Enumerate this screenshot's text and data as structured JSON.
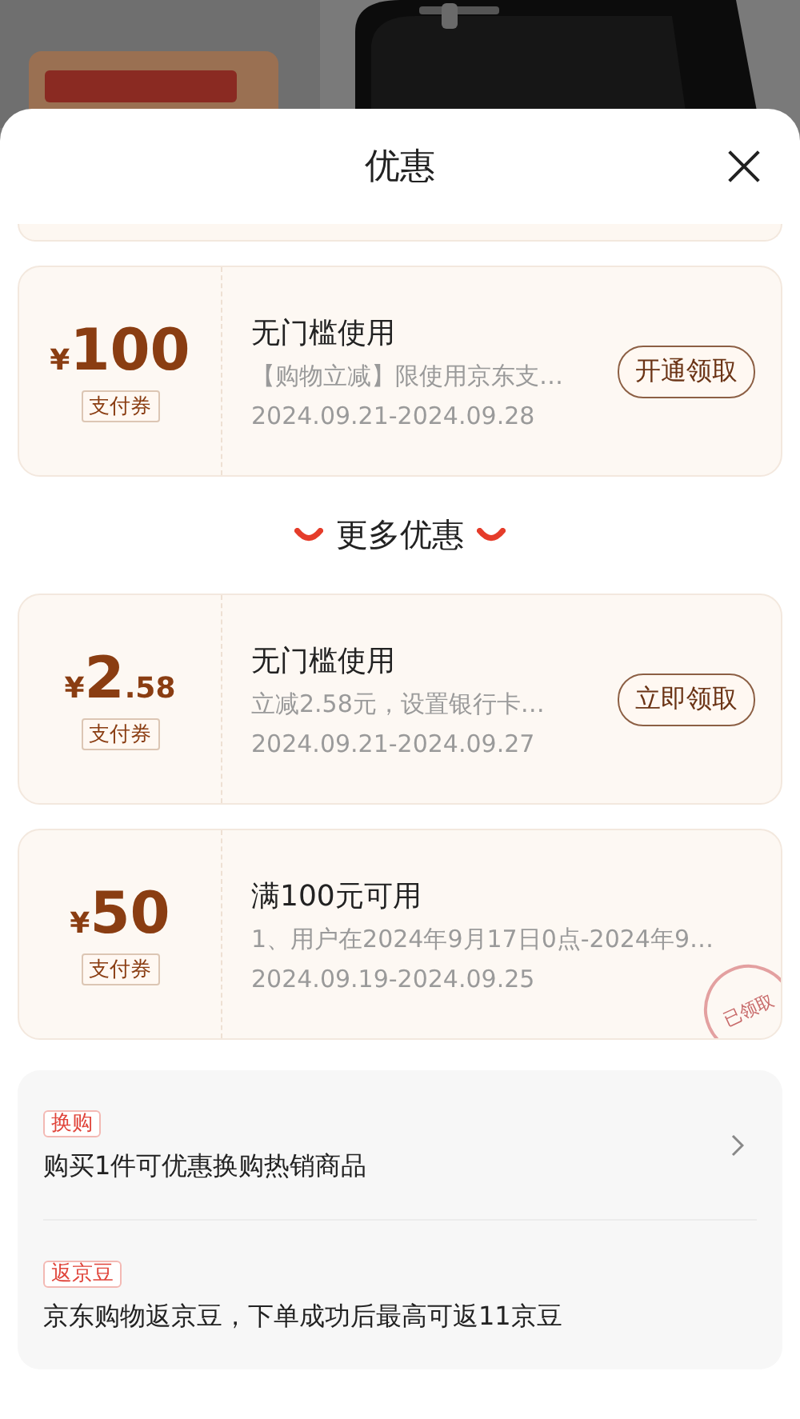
{
  "sheet": {
    "title": "优惠"
  },
  "coupons": [
    {
      "currency": "¥",
      "amount": "100",
      "tag": "支付券",
      "title": "无门槛使用",
      "description": "【购物立减】限使用京东支…",
      "validity": "2024.09.21-2024.09.28",
      "button": "开通领取"
    }
  ],
  "more_section": {
    "title": "更多优惠"
  },
  "more_coupons": [
    {
      "currency": "¥",
      "amount": "2",
      "decimal": ".58",
      "tag": "支付券",
      "title": "无门槛使用",
      "description": "立减2.58元，设置银行卡…",
      "validity": "2024.09.21-2024.09.27",
      "button": "立即领取"
    },
    {
      "currency": "¥",
      "amount": "50",
      "tag": "支付券",
      "title": "满100元可用",
      "description": "1、用户在2024年9月17日0点-2024年9…",
      "validity": "2024.09.19-2024.09.25",
      "stamp": "已领取"
    }
  ],
  "promotions": [
    {
      "tag": "换购",
      "text": "购买1件可优惠换购热销商品",
      "has_arrow": true
    },
    {
      "tag": "返京豆",
      "text": "京东购物返京豆，下单成功后最高可返11京豆",
      "has_arrow": false
    }
  ]
}
